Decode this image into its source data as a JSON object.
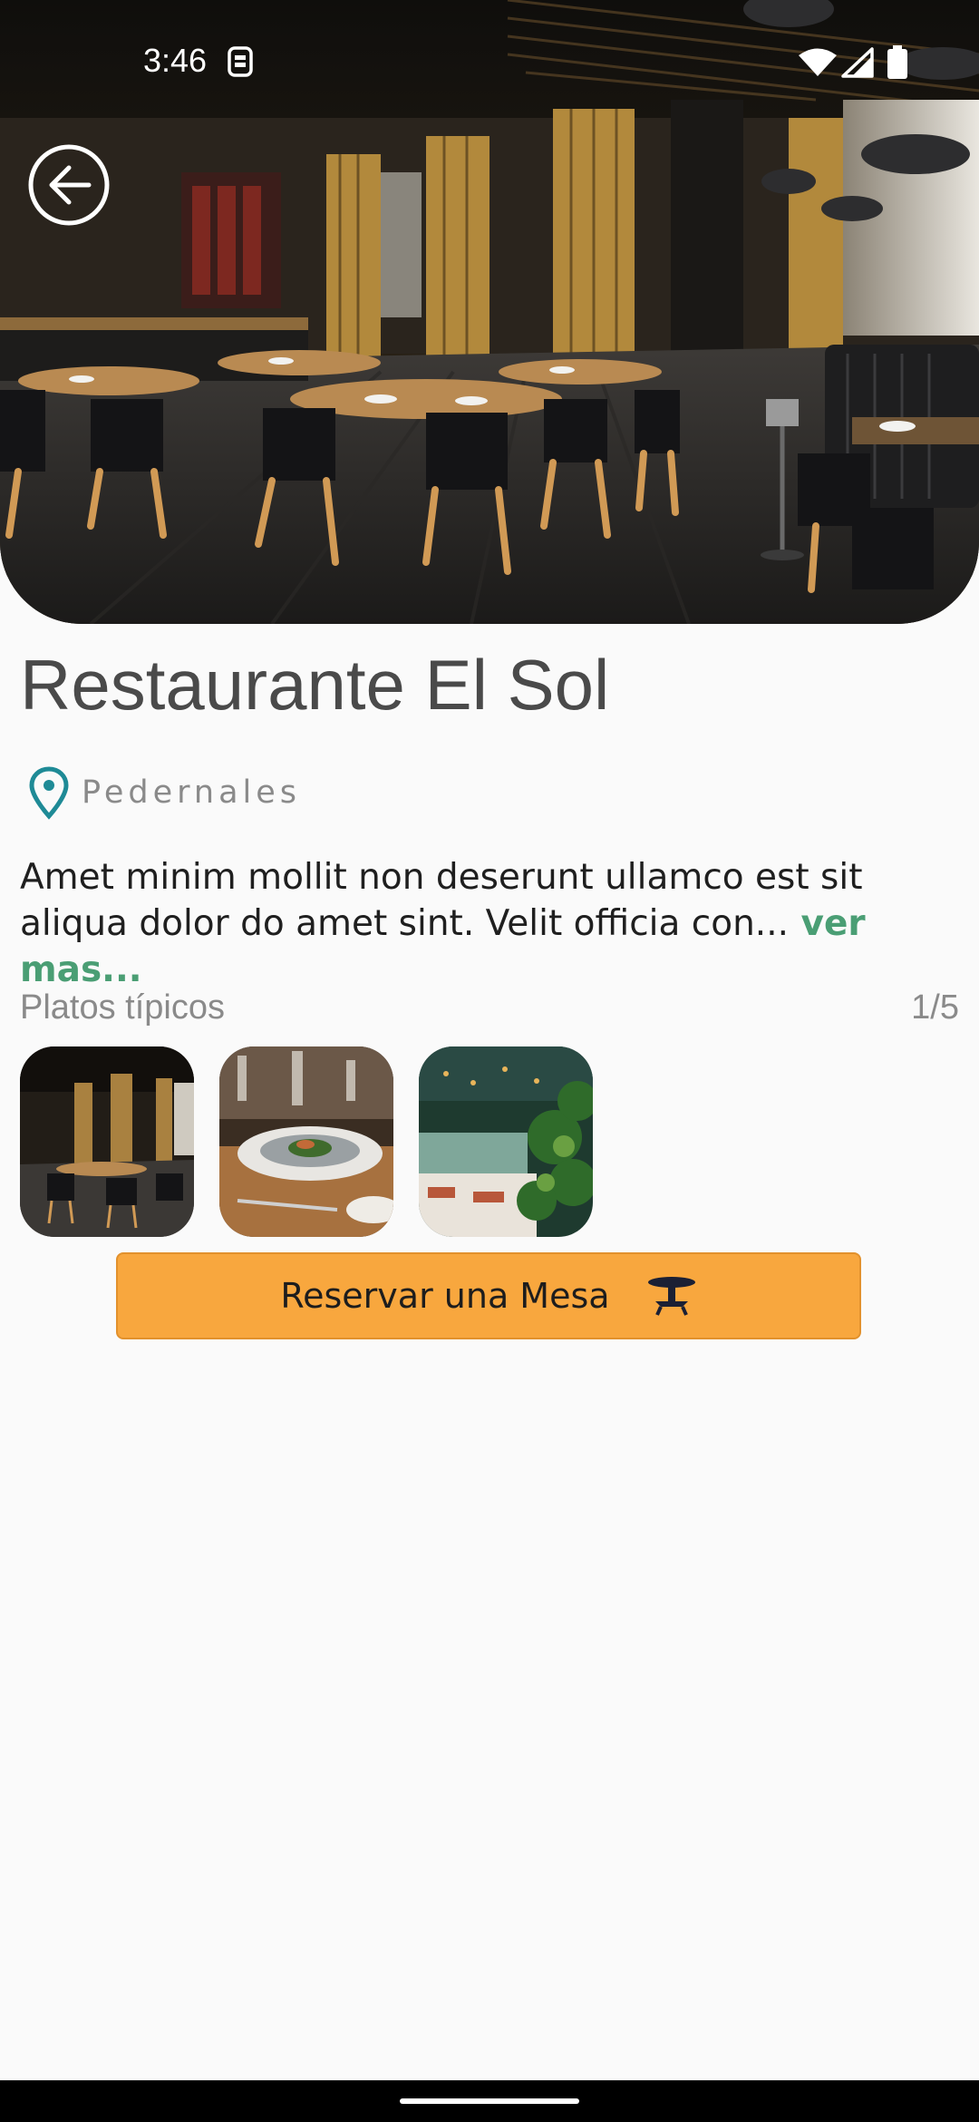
{
  "status_bar": {
    "time": "3:46",
    "icons": [
      "sim-card-icon",
      "wifi-icon",
      "signal-icon",
      "battery-icon"
    ]
  },
  "hero": {
    "image": "restaurant-interior-photo",
    "back_icon": "arrow-left-circle-icon"
  },
  "restaurant": {
    "name": "Restaurante El Sol",
    "location_icon": "map-pin-icon",
    "location": "Pedernales",
    "description": "Amet minim mollit non deserunt ullamco est sit aliqua dolor do amet sint. Velit officia con...",
    "read_more": " ver mas..."
  },
  "dishes": {
    "title": "Platos típicos",
    "counter": "1/5",
    "thumbnails": [
      "restaurant-interior-thumb",
      "plated-dish-thumb",
      "garden-terrace-thumb"
    ]
  },
  "reserve_button": {
    "label": "Reservar una Mesa",
    "icon": "table-icon"
  },
  "colors": {
    "accent": "#f8a73e",
    "link": "#4a9e74",
    "pin": "#1e8a96",
    "title": "#4a4a4a",
    "background": "#fafafa"
  }
}
